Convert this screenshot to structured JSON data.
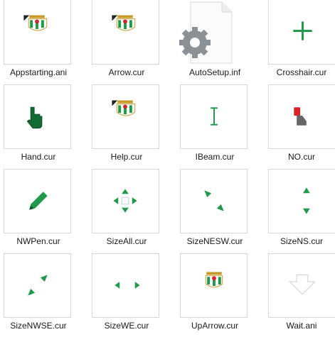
{
  "files": [
    {
      "name": "Appstarting.ani",
      "icon": "betis-crest-with-arrow-icon"
    },
    {
      "name": "Arrow.cur",
      "icon": "betis-crest-with-arrow-icon"
    },
    {
      "name": "AutoSetup.inf",
      "icon": "settings-file-icon"
    },
    {
      "name": "Crosshair.cur",
      "icon": "crosshair-icon"
    },
    {
      "name": "Hand.cur",
      "icon": "hand-pointer-icon"
    },
    {
      "name": "Help.cur",
      "icon": "betis-crest-with-arrow-icon"
    },
    {
      "name": "IBeam.cur",
      "icon": "ibeam-icon"
    },
    {
      "name": "NO.cur",
      "icon": "no-cursor-icon"
    },
    {
      "name": "NWPen.cur",
      "icon": "pen-icon"
    },
    {
      "name": "SizeAll.cur",
      "icon": "move-arrows-icon"
    },
    {
      "name": "SizeNESW.cur",
      "icon": "resize-nesw-icon"
    },
    {
      "name": "SizeNS.cur",
      "icon": "resize-ns-icon"
    },
    {
      "name": "SizeNWSE.cur",
      "icon": "resize-nwse-icon"
    },
    {
      "name": "SizeWE.cur",
      "icon": "resize-we-icon"
    },
    {
      "name": "UpArrow.cur",
      "icon": "betis-crest-icon"
    },
    {
      "name": "Wait.ani",
      "icon": "wait-arrow-icon"
    }
  ],
  "colors": {
    "green": "#1f9a4b",
    "gold": "#c79a2a",
    "red": "#d8232a",
    "gray": "#8c9196"
  }
}
